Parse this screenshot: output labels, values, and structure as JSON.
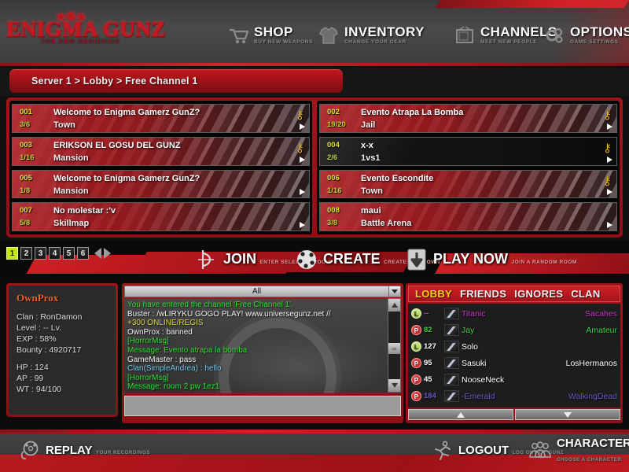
{
  "app": {
    "logo_main": "ENIGMA GUNZ",
    "logo_sub": "THE NEW BEGINNING"
  },
  "topnav": [
    {
      "title": "SHOP",
      "desc": "BUY NEW WEAPONS",
      "icon": "cart-icon"
    },
    {
      "title": "INVENTORY",
      "desc": "CHANGE YOUR GEAR",
      "icon": "shirt-icon"
    },
    {
      "title": "CHANNELS",
      "desc": "MEET NEW PEOPLE",
      "icon": "tv-icon"
    },
    {
      "title": "OPTIONS",
      "desc": "GAME SETTINGS",
      "icon": "gear-icon"
    }
  ],
  "breadcrumb": {
    "text": "Server 1 > Lobby > Free Channel 1"
  },
  "rooms": {
    "left": [
      {
        "no": "001",
        "cap": "3/6",
        "name": "Welcome to Enigma Gamerz GunZ?",
        "map": "Town",
        "locked": true,
        "occupied": true
      },
      {
        "no": "003",
        "cap": "1/16",
        "name": "ERIKSON EL GOSU DEL GUNZ",
        "map": "Mansion",
        "locked": true,
        "occupied": true
      },
      {
        "no": "005",
        "cap": "1/8",
        "name": "Welcome to Enigma Gamerz GunZ?",
        "map": "Mansion",
        "locked": false,
        "occupied": true
      },
      {
        "no": "007",
        "cap": "5/8",
        "name": "No molestar :'v",
        "map": "Skillmap",
        "locked": false,
        "occupied": true
      }
    ],
    "right": [
      {
        "no": "002",
        "cap": "19/20",
        "name": "Evento Atrapa La Bomba",
        "map": "Jail",
        "locked": true,
        "occupied": true
      },
      {
        "no": "004",
        "cap": "2/6",
        "name": "x-x",
        "map": "1vs1",
        "locked": true,
        "occupied": false
      },
      {
        "no": "006",
        "cap": "1/16",
        "name": "Evento Escondite",
        "map": "Town",
        "locked": true,
        "occupied": true
      },
      {
        "no": "008",
        "cap": "3/8",
        "name": "maui",
        "map": "Battle Arena",
        "locked": false,
        "occupied": true
      }
    ]
  },
  "pagination": {
    "pages": [
      "1",
      "2",
      "3",
      "4",
      "5",
      "6"
    ],
    "active": "1",
    "prev_label": "prev-page",
    "next_label": "next-page"
  },
  "actions": [
    {
      "title": "JOIN",
      "desc": "ENTER SELECTED ROOM",
      "icon": "join-icon"
    },
    {
      "title": "CREATE",
      "desc": "CREATE YOUR OWN",
      "icon": "palette-icon"
    },
    {
      "title": "PLAY NOW",
      "desc": "JOIN A RANDOM ROOM",
      "icon": "download-arrow-icon"
    }
  ],
  "character": {
    "name": "OwnProx",
    "clan": "Clan : RonDamon",
    "level": "Level : -- Lv.",
    "exp": "EXP : 58%",
    "bounty": "Bounty : 4920717",
    "hp": "HP : 124",
    "ap": "AP : 99",
    "wt": "WT : 94/100"
  },
  "chat": {
    "filter_selected": "All",
    "input_value": "",
    "input_placeholder": "",
    "lines": [
      {
        "text": "You have entered the channel 'Free Channel 1'.",
        "color": "#2ee02e"
      },
      {
        "text": "Buster : /wLIRYKU  GOGO PLAY! www.universegunz.net //",
        "color": "#f0f0f0"
      },
      {
        "text": "               +300 ONLINE/REGIS",
        "color": "#d8d83c"
      },
      {
        "text": "OwnProx : banned",
        "color": "#f0f0f0"
      },
      {
        "text": "[HorrorMsg]",
        "color": "#2ee02e"
      },
      {
        "text": "Message: Evento atrapa la bomba",
        "color": "#2ee02e"
      },
      {
        "text": "GameMaster : pass",
        "color": "#f0f0f0"
      },
      {
        "text": "Clan(SimpleAndrea) : hello",
        "color": "#6fc8f0"
      },
      {
        "text": "[HorrorMsg]",
        "color": "#2ee02e"
      },
      {
        "text": "Message: room 2 pw 1ez1",
        "color": "#2ee02e"
      }
    ]
  },
  "friends": {
    "tabs": [
      {
        "label": "LOBBY",
        "active": true
      },
      {
        "label": "FRIENDS",
        "active": false
      },
      {
        "label": "IGNORES",
        "active": false
      },
      {
        "label": "CLAN",
        "active": false
      }
    ],
    "rows": [
      {
        "state": "L",
        "level": "--",
        "name": "Titanic",
        "name_color": "#c838c8",
        "clan": "Sacahes",
        "clan_color": "#c838c8",
        "level_color": "#c838c8"
      },
      {
        "state": "P",
        "level": "82",
        "name": "Jay",
        "name_color": "#3fd43f",
        "clan": "Amateur",
        "clan_color": "#3fd43f",
        "level_color": "#3fd43f"
      },
      {
        "state": "L",
        "level": "127",
        "name": "Solo",
        "name_color": "#ffffff",
        "clan": "",
        "clan_color": "#ffffff",
        "level_color": "#ffffff"
      },
      {
        "state": "P",
        "level": "95",
        "name": "Sasuki",
        "name_color": "#ffffff",
        "clan": "LosHermanos",
        "clan_color": "#ffffff",
        "level_color": "#ffffff"
      },
      {
        "state": "P",
        "level": "45",
        "name": "NooseNeck",
        "name_color": "#ffffff",
        "clan": "",
        "clan_color": "#ffffff",
        "level_color": "#ffffff"
      },
      {
        "state": "P",
        "level": "184",
        "name": "-Emerald",
        "name_color": "#6a5acd",
        "clan": "WalkingDead",
        "clan_color": "#6a5acd",
        "level_color": "#6a5acd"
      }
    ]
  },
  "bottom": [
    {
      "title": "REPLAY",
      "desc": "YOUR RECORDINGS",
      "icon": "film-reel-icon"
    },
    {
      "title": "LOGOUT",
      "desc": "LOG OUT OF GUNZ",
      "icon": "running-man-icon"
    },
    {
      "title": "CHARACTERS",
      "desc": "CHOOSE A CHARACTER",
      "icon": "people-icon"
    }
  ],
  "colors": {
    "brand_red": "#c21820",
    "accent_yellow": "#f2d21c",
    "panel_dark": "#1d1d1d"
  }
}
